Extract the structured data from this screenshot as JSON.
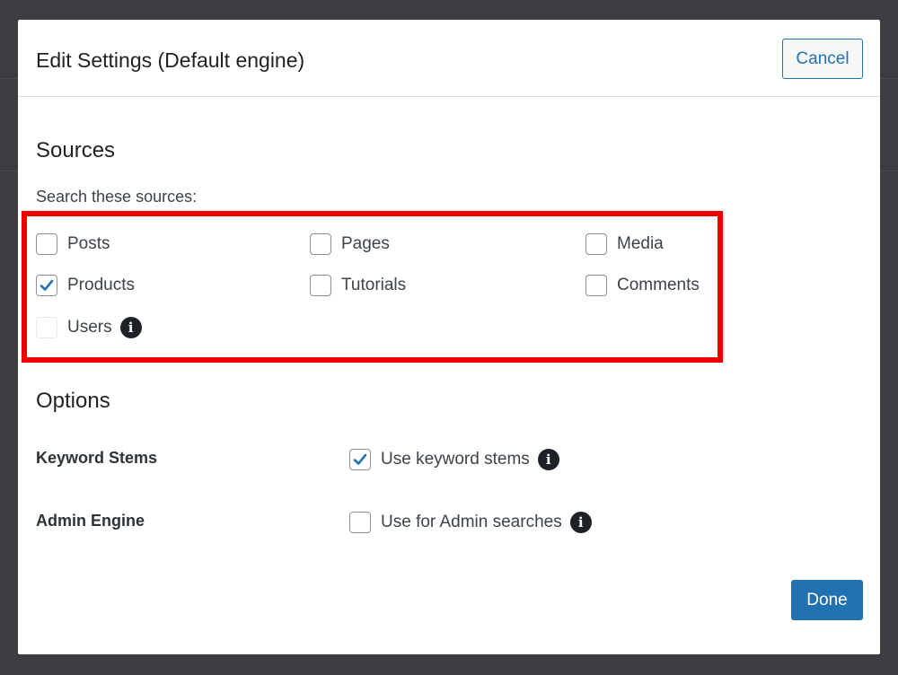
{
  "modal": {
    "title": "Edit Settings (Default engine)",
    "cancel_label": "Cancel",
    "done_label": "Done"
  },
  "sources": {
    "heading": "Sources",
    "description": "Search these sources:",
    "items": [
      {
        "label": "Posts",
        "checked": false,
        "disabled": false
      },
      {
        "label": "Pages",
        "checked": false,
        "disabled": false
      },
      {
        "label": "Media",
        "checked": false,
        "disabled": false
      },
      {
        "label": "Products",
        "checked": true,
        "disabled": false
      },
      {
        "label": "Tutorials",
        "checked": false,
        "disabled": false
      },
      {
        "label": "Comments",
        "checked": false,
        "disabled": false
      },
      {
        "label": "Users",
        "checked": false,
        "disabled": true,
        "info_icon": "info-icon"
      }
    ]
  },
  "options": {
    "heading": "Options",
    "keyword_stems": {
      "label": "Keyword Stems",
      "checkbox_label": "Use keyword stems",
      "checked": true,
      "info_icon": "info-icon"
    },
    "admin_engine": {
      "label": "Admin Engine",
      "checkbox_label": "Use for Admin searches",
      "checked": false,
      "info_icon": "info-icon"
    }
  },
  "colors": {
    "accent": "#2271b1",
    "highlight": "#ee0000",
    "backdrop": "#3c3d40"
  }
}
